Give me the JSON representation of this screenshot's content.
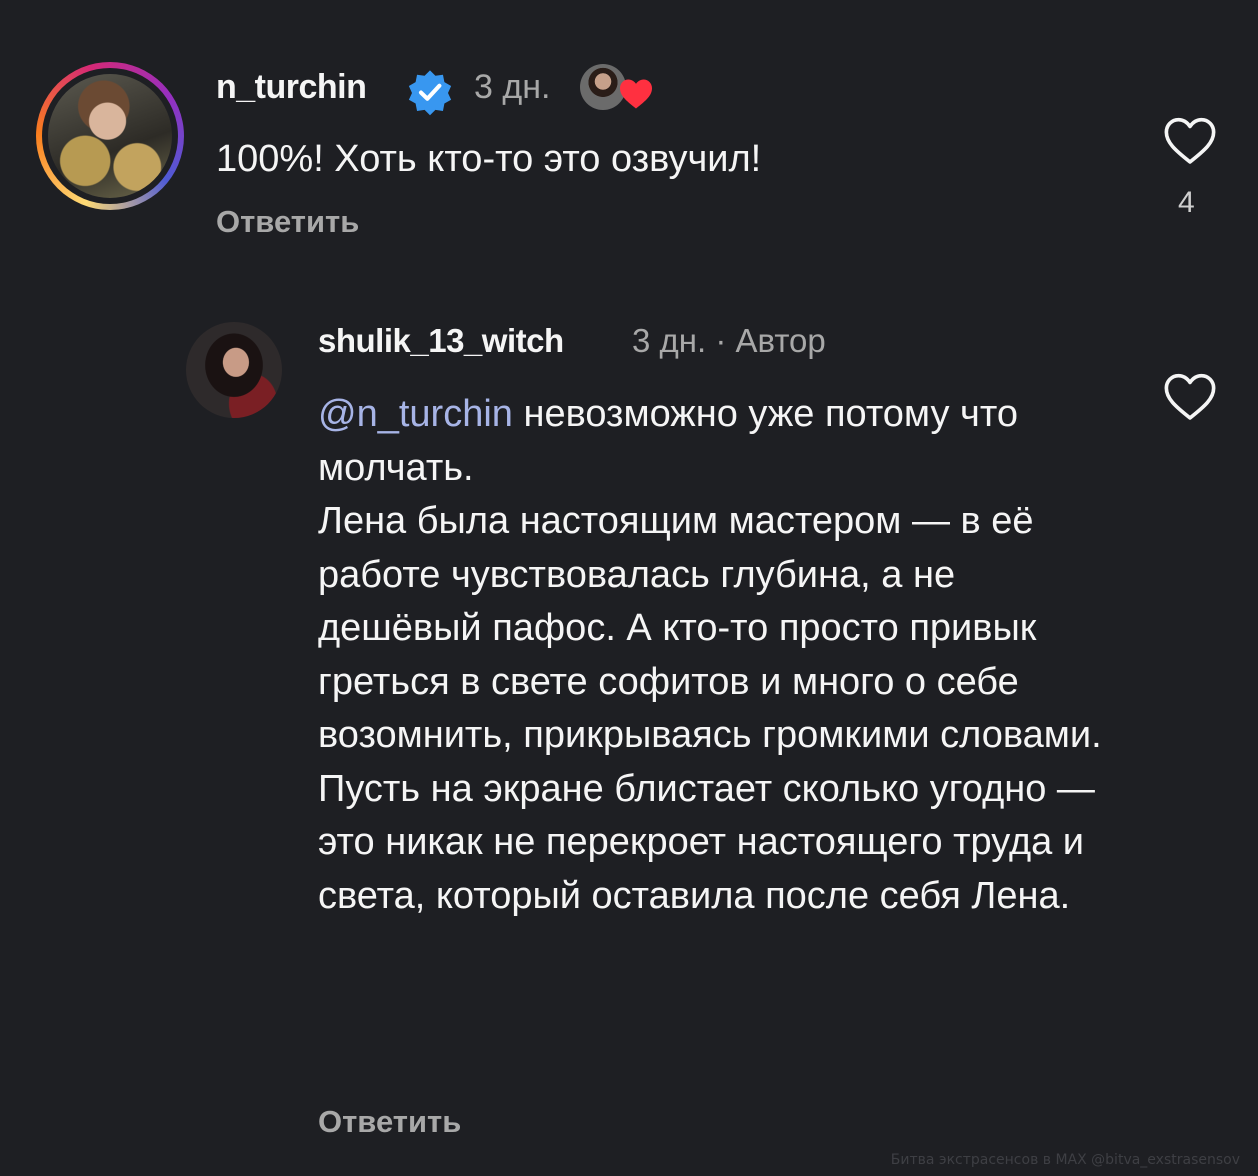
{
  "comments": [
    {
      "username": "n_turchin",
      "verified": true,
      "time": "3 дн.",
      "text": "100%! Хоть кто-то это озвучил!",
      "reply_label": "Ответить",
      "likes": "4",
      "liked_by_author": true
    },
    {
      "username": "shulik_13_witch",
      "time_author": "3 дн. · Автор",
      "mention": "@n_turchin",
      "text": " невозможно уже потому что молчать.\nЛена была настоящим мастером — в её работе чувствовалась глубина, а не дешёвый пафос. А кто-то просто привык греться в свете софитов и много о себе возомнить, прикрываясь громкими словами. Пусть на экране блистает сколько угодно — это никак не перекроет настоящего труда и света, который оставила после себя Лена.",
      "reply_label": "Ответить"
    }
  ],
  "watermark": "Битва экстрасенсов в MAX @bitva_exstrasensov",
  "colors": {
    "background": "#1e1f23",
    "text": "#f5f5f5",
    "secondary": "#a8a8a8",
    "mention": "#a7b4e6",
    "verified": "#3897f0",
    "heart": "#ff3040"
  },
  "icons": [
    "verified-badge-icon",
    "heart-outline-icon",
    "heart-filled-icon"
  ]
}
